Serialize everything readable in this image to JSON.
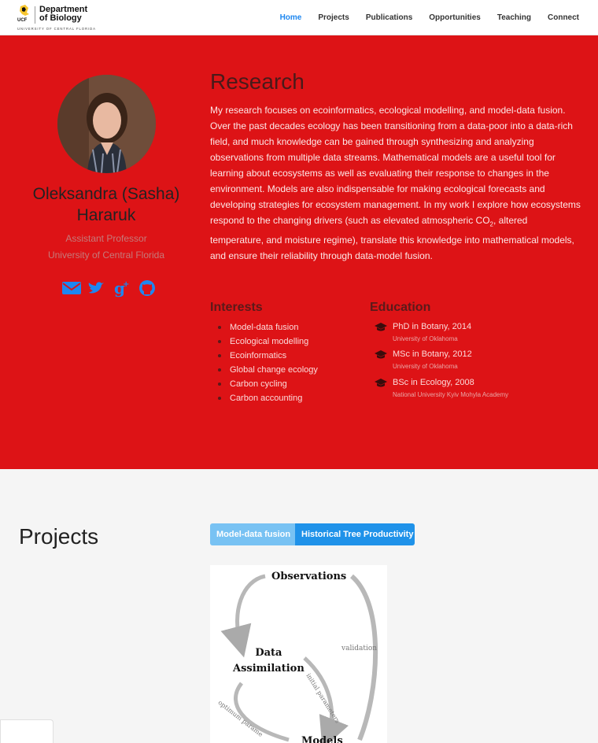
{
  "nav": {
    "logo_title": "Department\nof Biology",
    "logo_ucf": "UCF",
    "logo_sub": "UNIVERSITY OF CENTRAL FLORIDA",
    "items": [
      {
        "label": "Home",
        "active": true
      },
      {
        "label": "Projects"
      },
      {
        "label": "Publications"
      },
      {
        "label": "Opportunities"
      },
      {
        "label": "Teaching"
      },
      {
        "label": "Connect"
      }
    ]
  },
  "profile": {
    "name": "Oleksandra (Sasha) Hararuk",
    "title": "Assistant Professor",
    "affiliation": "University of Central Florida",
    "socials": [
      "email-icon",
      "twitter-icon",
      "google-plus-icon",
      "github-icon"
    ]
  },
  "research": {
    "heading": "Research",
    "text_before_sub": "My research focuses on ecoinformatics, ecological modelling, and model-data fusion. Over the past decades ecology has been transitioning from a data-poor into a data-rich field, and much knowledge can be gained through synthesizing and analyzing observations from multiple data streams. Mathematical models are a useful tool for learning about ecosystems as well as evaluating their response to changes in the environment. Models are also indispensable for making ecological forecasts and developing strategies for ecosystem management. In my work I explore how ecosystems respond to the changing drivers (such as elevated atmospheric CO",
    "subscript": "2",
    "text_after_sub": ", altered temperature, and moisture regime), translate this knowledge into mathematical models, and ensure their reliability through data-model fusion."
  },
  "interests": {
    "heading": "Interests",
    "items": [
      "Model-data fusion",
      "Ecological modelling",
      "Ecoinformatics",
      "Global change ecology",
      "Carbon cycling",
      "Carbon accounting"
    ]
  },
  "education": {
    "heading": "Education",
    "items": [
      {
        "degree": "PhD in Botany, 2014",
        "school": "University of Oklahoma"
      },
      {
        "degree": "MSc in Botany, 2012",
        "school": "University of Oklahoma"
      },
      {
        "degree": "BSc in Ecology, 2008",
        "school": "National University Kyiv Mohyla Academy"
      }
    ]
  },
  "projects": {
    "heading": "Projects",
    "tabs": [
      "Model-data fusion",
      "Historical Tree Productivity"
    ],
    "figure": {
      "observations": "Observations",
      "data_assimilation": "Data\nAssimilation",
      "validation": "validation",
      "initial_parameters": "initial parameters",
      "optimum_parameters": "optimum parame",
      "models": "Models"
    }
  },
  "colors": {
    "hero_bg": "#dd1316",
    "accent": "#1e87f0",
    "tab_active": "#78c2f3",
    "tab": "#1f92e9"
  }
}
